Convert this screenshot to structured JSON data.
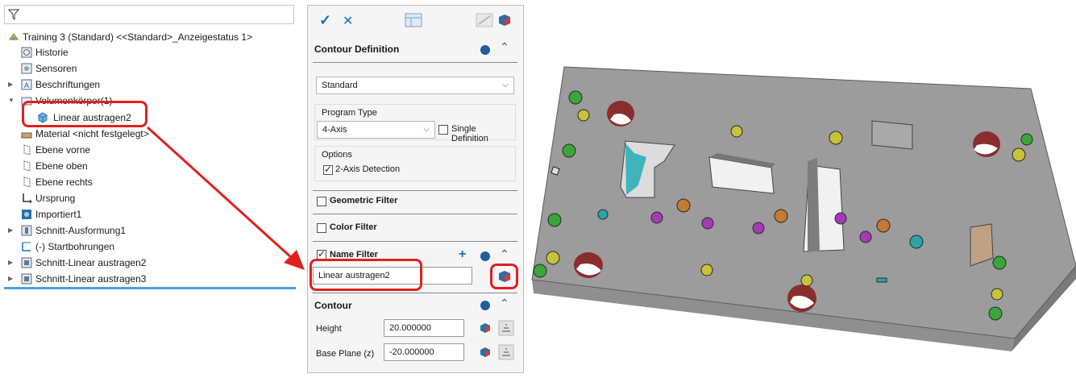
{
  "tree": {
    "filter_icon": "funnel-icon",
    "items": [
      {
        "label": "Training 3 (Standard) <<Standard>_Anzeigestatus 1>",
        "icon": "part-icon"
      },
      {
        "label": "Historie",
        "icon": "history-icon"
      },
      {
        "label": "Sensoren",
        "icon": "sensor-icon"
      },
      {
        "label": "Beschriftungen",
        "icon": "annotation-icon"
      },
      {
        "label": "Volumenkörper(1)",
        "icon": "solid-bodies-icon"
      },
      {
        "label": "Linear austragen2",
        "icon": "body-icon"
      },
      {
        "label": "Material <nicht festgelegt>",
        "icon": "material-icon"
      },
      {
        "label": "Ebene vorne",
        "icon": "plane-icon"
      },
      {
        "label": "Ebene oben",
        "icon": "plane-icon"
      },
      {
        "label": "Ebene rechts",
        "icon": "plane-icon"
      },
      {
        "label": "Ursprung",
        "icon": "origin-icon"
      },
      {
        "label": "Importiert1",
        "icon": "import-icon"
      },
      {
        "label": "Schnitt-Ausformung1",
        "icon": "cut-icon"
      },
      {
        "label": "(-) Startbohrungen",
        "icon": "sketch-icon"
      },
      {
        "label": "Schnitt-Linear austragen2",
        "icon": "cut-icon"
      },
      {
        "label": "Schnitt-Linear austragen3",
        "icon": "cut-icon"
      }
    ]
  },
  "pm": {
    "ok_icon": "checkmark-icon",
    "cancel_icon": "close-icon",
    "contour_definition": {
      "title": "Contour Definition",
      "standard_select": "Standard",
      "program_type_label": "Program Type",
      "program_type_value": "4-Axis",
      "single_definition_label": "Single Definition",
      "single_definition_checked": false,
      "options_label": "Options",
      "two_axis_label": "2-Axis Detection",
      "two_axis_checked": true
    },
    "geometric_filter": {
      "label": "Geometric Filter",
      "checked": false
    },
    "color_filter": {
      "label": "Color Filter",
      "checked": false
    },
    "name_filter": {
      "label": "Name Filter",
      "checked": true,
      "value": "Linear austragen2"
    },
    "contour": {
      "title": "Contour",
      "height_label": "Height",
      "height_value": "20.000000",
      "base_plane_label": "Base Plane (z)",
      "base_plane_value": "-20.000000"
    }
  },
  "colors": {
    "accent": "#1f6fb5",
    "highlight_red": "#e02020",
    "tree_selection_line": "#4aa3df",
    "part_grey": "#9c9c9c"
  }
}
